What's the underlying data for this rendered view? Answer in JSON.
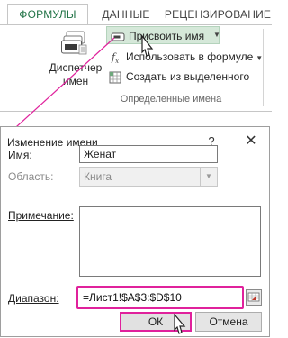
{
  "ribbon": {
    "tabs": [
      {
        "label": "ФОРМУЛЫ",
        "active": true
      },
      {
        "label": "ДАННЫЕ",
        "active": false
      },
      {
        "label": "РЕЦЕНЗИРОВАНИЕ",
        "active": false
      }
    ],
    "name_manager_label_1": "Диспетчер",
    "name_manager_label_2": "имен",
    "assign_name_label": "Присвоить имя",
    "use_in_formula_label": "Использовать в формуле",
    "create_from_selection_label": "Создать из выделенного",
    "group_label": "Определенные имена",
    "accent_color": "#217346"
  },
  "dialog": {
    "title": "Изменение имени",
    "help_glyph": "?",
    "close_glyph": "✕",
    "name_label": "Имя:",
    "name_value": "Женат",
    "scope_label": "Область:",
    "scope_value": "Книга",
    "comment_label": "Примечание:",
    "comment_value": "",
    "range_label": "Диапазон:",
    "range_value": "=Лист1!$A$3:$D$10",
    "ok_label": "ОК",
    "cancel_label": "Отмена",
    "highlight_color": "#e0219c"
  }
}
